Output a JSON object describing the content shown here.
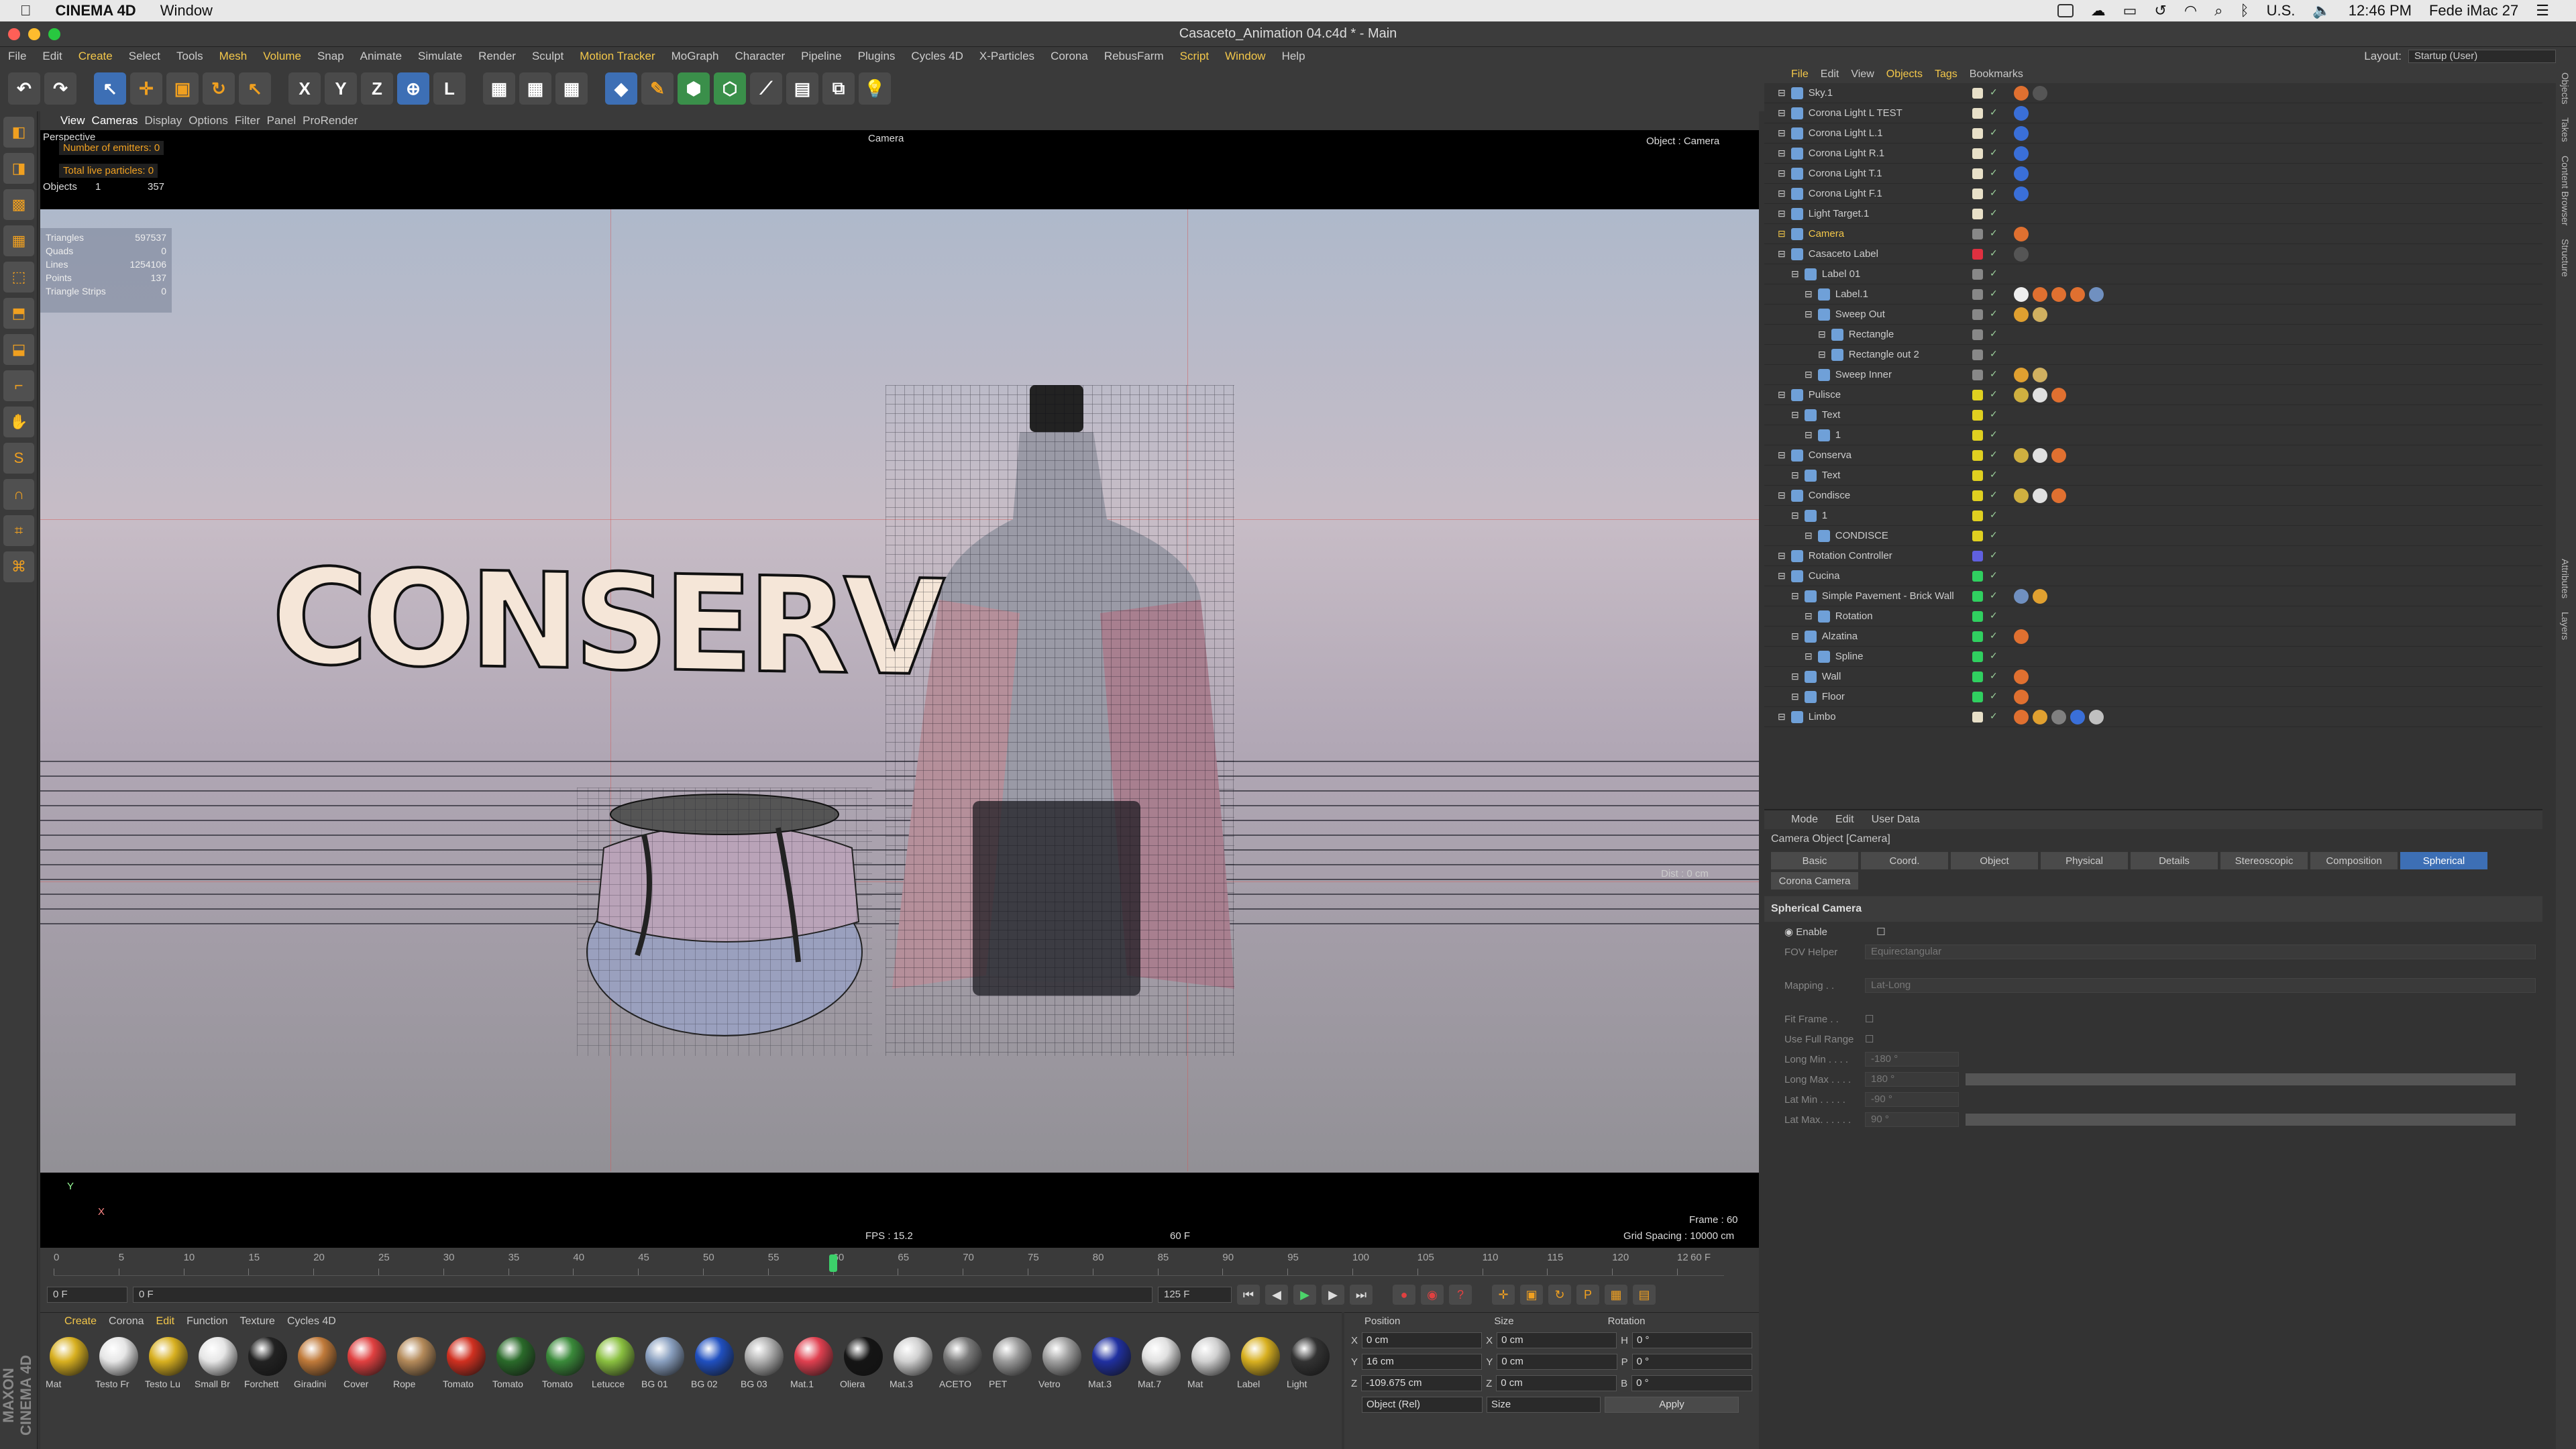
{
  "macbar": {
    "apple": "",
    "app": "CINEMA 4D",
    "window": "Window",
    "locale": "U.S.",
    "time": "12:46 PM",
    "date": "Fede iMac 27"
  },
  "titlebar": {
    "title": "Casaceto_Animation 04.c4d * - Main"
  },
  "menubar": {
    "items": [
      "File",
      "Edit",
      "Create",
      "Select",
      "Tools",
      "Mesh",
      "Volume",
      "Snap",
      "Animate",
      "Simulate",
      "Render",
      "Sculpt",
      "Motion Tracker",
      "MoGraph",
      "Character",
      "Pipeline",
      "Plugins",
      "Cycles 4D",
      "X-Particles",
      "Corona",
      "RebusFarm",
      "Script",
      "Window",
      "Help"
    ],
    "layout_label": "Layout:",
    "layout_value": "Startup (User)"
  },
  "viewport": {
    "menu": [
      "View",
      "Cameras",
      "Display",
      "Options",
      "Filter",
      "Panel",
      "ProRender"
    ],
    "projection": "Perspective",
    "camera_label": "Camera",
    "object_label": "Object : Camera",
    "emitters": "Number of emitters: 0",
    "particles": "Total live particles: 0",
    "objects_label": "Objects",
    "objects_count": "1",
    "objects_total": "357",
    "stats": [
      {
        "k": "Triangles",
        "v": "597537"
      },
      {
        "k": "Quads",
        "v": "0"
      },
      {
        "k": "Lines",
        "v": "1254106"
      },
      {
        "k": "Points",
        "v": "137"
      },
      {
        "k": "Triangle Strips",
        "v": "0"
      }
    ],
    "scene_text": "CONSERVA",
    "dist": "Dist : 0 cm",
    "fps": "FPS : 15.2",
    "frame_mid": "60 F",
    "frame": "Frame : 60",
    "grid": "Grid Spacing : 10000 cm",
    "axis_y": "Y",
    "axis_x": "X"
  },
  "timeline": {
    "ticks": [
      "0",
      "5",
      "10",
      "15",
      "20",
      "25",
      "30",
      "35",
      "40",
      "45",
      "50",
      "55",
      "60",
      "65",
      "70",
      "75",
      "80",
      "85",
      "90",
      "95",
      "100",
      "105",
      "110",
      "115",
      "120",
      "12"
    ],
    "current_frame_label": "60 F",
    "start": "0 F",
    "range_start": "0 F",
    "range_end": "125 F",
    "end": "125 F",
    "current_frame": 60
  },
  "materials": {
    "menu": [
      "Create",
      "Corona",
      "Edit",
      "Function",
      "Texture",
      "Cycles 4D"
    ],
    "items": [
      {
        "name": "Mat",
        "color": "#d8b020"
      },
      {
        "name": "Testo Fr",
        "color": "#e6e6e6"
      },
      {
        "name": "Testo Lu",
        "color": "#d8b020"
      },
      {
        "name": "Small Br",
        "color": "#e6e6e6"
      },
      {
        "name": "Forchett",
        "color": "#222222"
      },
      {
        "name": "Giradini",
        "color": "#c07a3a"
      },
      {
        "name": "Cover",
        "color": "#e04040"
      },
      {
        "name": "Rope",
        "color": "#b48a5a"
      },
      {
        "name": "Tomato",
        "color": "#d03020"
      },
      {
        "name": "Tomato",
        "color": "#2a6a2a"
      },
      {
        "name": "Tomato",
        "color": "#3a8a3a"
      },
      {
        "name": "Letucce",
        "color": "#8ac040"
      },
      {
        "name": "BG 01",
        "color": "#8aa0c0"
      },
      {
        "name": "BG 02",
        "color": "#2050c0"
      },
      {
        "name": "BG 03",
        "color": "#b0b0b0"
      },
      {
        "name": "Mat.1",
        "color": "#e04050"
      },
      {
        "name": "Oliera",
        "color": "#151515"
      },
      {
        "name": "Mat.3",
        "color": "#d0d0d0"
      },
      {
        "name": "ACETO",
        "color": "#7a7a7a"
      },
      {
        "name": "PET",
        "color": "#9a9a9a"
      },
      {
        "name": "Vetro",
        "color": "#a0a0a0"
      },
      {
        "name": "Mat.3",
        "color": "#2030a0"
      },
      {
        "name": "Mat.7",
        "color": "#e0e0e0"
      },
      {
        "name": "Mat",
        "color": "#d0d0d0"
      },
      {
        "name": "Label",
        "color": "#d8b020"
      },
      {
        "name": "Light",
        "color": "#333333"
      }
    ]
  },
  "coords": {
    "headers": [
      "Position",
      "Size",
      "Rotation"
    ],
    "rows": [
      {
        "a": "X",
        "pos": "0 cm",
        "b": "X",
        "size": "0 cm",
        "c": "H",
        "rot": "0 °"
      },
      {
        "a": "Y",
        "pos": "16 cm",
        "b": "Y",
        "size": "0 cm",
        "c": "P",
        "rot": "0 °"
      },
      {
        "a": "Z",
        "pos": "-109.675 cm",
        "b": "Z",
        "size": "0 cm",
        "c": "B",
        "rot": "0 °"
      }
    ],
    "mode": "Object (Rel)",
    "size_mode": "Size",
    "apply": "Apply"
  },
  "objects": {
    "menu": [
      "File",
      "Edit",
      "View",
      "Objects",
      "Tags",
      "Bookmarks"
    ],
    "rows": [
      {
        "name": "Sky.1",
        "indent": 0,
        "layer": "#e8e0c8",
        "tags": [
          "#e07030",
          "#555555"
        ]
      },
      {
        "name": "Corona Light L TEST",
        "indent": 0,
        "layer": "#e8e0c8",
        "tags": [
          "#3a6fd8"
        ]
      },
      {
        "name": "Corona Light L.1",
        "indent": 0,
        "layer": "#e8e0c8",
        "tags": [
          "#3a6fd8"
        ]
      },
      {
        "name": "Corona Light R.1",
        "indent": 0,
        "layer": "#e8e0c8",
        "tags": [
          "#3a6fd8"
        ]
      },
      {
        "name": "Corona Light T.1",
        "indent": 0,
        "layer": "#e8e0c8",
        "tags": [
          "#3a6fd8"
        ]
      },
      {
        "name": "Corona Light F.1",
        "indent": 0,
        "layer": "#e8e0c8",
        "tags": [
          "#3a6fd8"
        ]
      },
      {
        "name": "Light Target.1",
        "indent": 0,
        "layer": "#e8e0c8",
        "tags": []
      },
      {
        "name": "Camera",
        "indent": 0,
        "layer": "#888888",
        "tags": [
          "#e07030"
        ],
        "highlight": true
      },
      {
        "name": "Casaceto Label",
        "indent": 0,
        "layer": "#e03040",
        "tags": [
          "#555555"
        ]
      },
      {
        "name": "Label 01",
        "indent": 1,
        "layer": "#888888",
        "tags": []
      },
      {
        "name": "Label.1",
        "indent": 2,
        "layer": "#888888",
        "tags": [
          "#eeeeee",
          "#e07030",
          "#e07030",
          "#e07030",
          "#7090c0"
        ]
      },
      {
        "name": "Sweep Out",
        "indent": 2,
        "layer": "#888888",
        "tags": [
          "#e0a030",
          "#d0b060"
        ]
      },
      {
        "name": "Rectangle",
        "indent": 3,
        "layer": "#888888",
        "tags": []
      },
      {
        "name": "Rectangle out 2",
        "indent": 3,
        "layer": "#888888",
        "tags": []
      },
      {
        "name": "Sweep Inner",
        "indent": 2,
        "layer": "#888888",
        "tags": [
          "#e0a030",
          "#d0b060"
        ]
      },
      {
        "name": "Pulisce",
        "indent": 0,
        "layer": "#e0d020",
        "tags": [
          "#d0b040",
          "#e0e0e0",
          "#e07030"
        ]
      },
      {
        "name": "Text",
        "indent": 1,
        "layer": "#e0d020",
        "tags": []
      },
      {
        "name": "1",
        "indent": 2,
        "layer": "#e0d020",
        "tags": []
      },
      {
        "name": "Conserva",
        "indent": 0,
        "layer": "#e0d020",
        "tags": [
          "#d0b040",
          "#e0e0e0",
          "#e07030"
        ]
      },
      {
        "name": "Text",
        "indent": 1,
        "layer": "#e0d020",
        "tags": []
      },
      {
        "name": "Condisce",
        "indent": 0,
        "layer": "#e0d020",
        "tags": [
          "#d0b040",
          "#e0e0e0",
          "#e07030"
        ]
      },
      {
        "name": "1",
        "indent": 1,
        "layer": "#e0d020",
        "tags": []
      },
      {
        "name": "CONDISCE",
        "indent": 2,
        "layer": "#e0d020",
        "tags": []
      },
      {
        "name": "Rotation Controller",
        "indent": 0,
        "layer": "#6060e0",
        "tags": []
      },
      {
        "name": "Cucina",
        "indent": 0,
        "layer": "#30d060",
        "tags": []
      },
      {
        "name": "Simple Pavement - Brick Wall",
        "indent": 1,
        "layer": "#30d060",
        "tags": [
          "#7090c0",
          "#e0a030"
        ]
      },
      {
        "name": "Rotation",
        "indent": 2,
        "layer": "#30d060",
        "tags": []
      },
      {
        "name": "Alzatina",
        "indent": 1,
        "layer": "#30d060",
        "tags": [
          "#e07030"
        ]
      },
      {
        "name": "Spline",
        "indent": 2,
        "layer": "#30d060",
        "tags": []
      },
      {
        "name": "Wall",
        "indent": 1,
        "layer": "#30d060",
        "tags": [
          "#e07030"
        ]
      },
      {
        "name": "Floor",
        "indent": 1,
        "layer": "#30d060",
        "tags": [
          "#e07030"
        ]
      },
      {
        "name": "Limbo",
        "indent": 0,
        "layer": "#e8e0c8",
        "tags": [
          "#e07030",
          "#e0a030",
          "#808080",
          "#3a6fd8",
          "#c0c0c0"
        ]
      }
    ]
  },
  "attributes": {
    "menu": [
      "Mode",
      "Edit",
      "User Data"
    ],
    "title": "Camera Object [Camera]",
    "tabs": [
      "Basic",
      "Coord.",
      "Object",
      "Physical",
      "Details",
      "Stereoscopic",
      "Composition",
      "Spherical"
    ],
    "active_tab": "Spherical",
    "subtab": "Corona Camera",
    "section": "Spherical Camera",
    "enable": "Enable",
    "fov_label": "FOV Helper",
    "fov_value": "Equirectangular",
    "mapping_label": "Mapping . .",
    "mapping_value": "Lat-Long",
    "fit_frame": "Fit Frame . .",
    "use_full": "Use Full Range",
    "long_min_label": "Long Min . . . .",
    "long_min": "-180 °",
    "long_max_label": "Long Max . . . .",
    "long_max": "180 °",
    "lat_min_label": "Lat Min . . . . .",
    "lat_min": "-90 °",
    "lat_max_label": "Lat Max. . . . . .",
    "lat_max": "90 °"
  },
  "right_strip": [
    "Objects",
    "Takes",
    "Content Browser",
    "Structure",
    "Attributes",
    "Layers"
  ],
  "maxon": "MAXON CINEMA 4D"
}
